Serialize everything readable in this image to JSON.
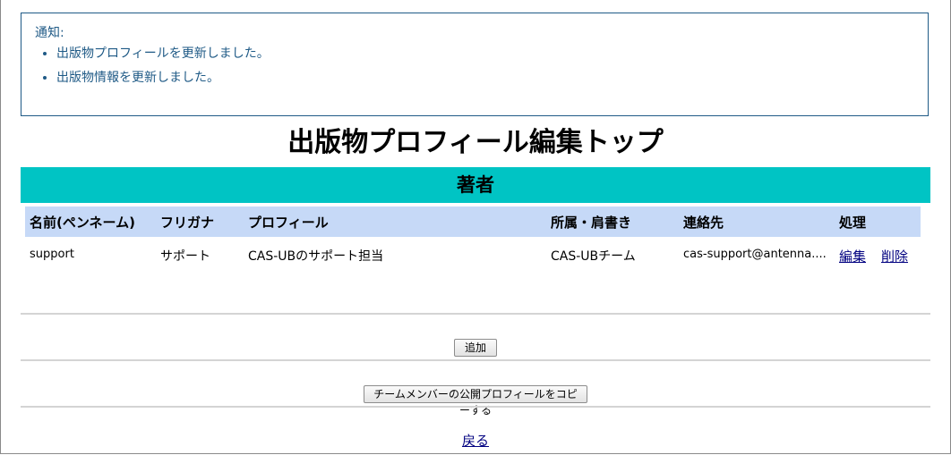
{
  "notice": {
    "title": "通知:",
    "messages": [
      "出版物プロフィールを更新しました。",
      "出版物情報を更新しました。"
    ]
  },
  "page": {
    "title": "出版物プロフィール編集トップ"
  },
  "section": {
    "title": "著者"
  },
  "table": {
    "headers": [
      "名前(ペンネーム)",
      "フリガナ",
      "プロフィール",
      "所属・肩書き",
      "連絡先",
      "処理"
    ],
    "rows": [
      {
        "name": "support",
        "furigana": "サポート",
        "profile": "CAS-UBのサポート担当",
        "affiliation": "CAS-UBチーム",
        "contact": "cas-support@antenna....",
        "edit_label": "編集",
        "delete_label": "削除"
      }
    ]
  },
  "buttons": {
    "add_label": "追加",
    "copy_label": "チームメンバーの公開プロフィールをコピーする"
  },
  "back_label": "戻る",
  "colors": {
    "notice_text": "#1f5a86",
    "section_bar": "#00c4c4",
    "table_header": "#c6d9f7",
    "link": "#000080"
  }
}
